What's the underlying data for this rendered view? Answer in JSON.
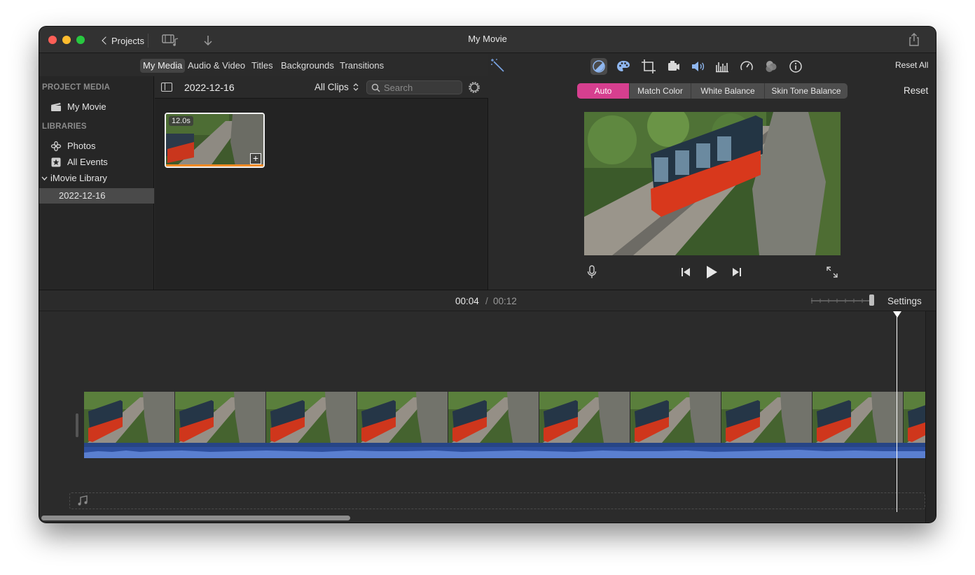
{
  "window": {
    "title": "My Movie"
  },
  "toolbar": {
    "projects_label": "Projects"
  },
  "browser_tabs": [
    "My Media",
    "Audio & Video",
    "Titles",
    "Backgrounds",
    "Transitions"
  ],
  "sidebar": {
    "project_media_header": "PROJECT MEDIA",
    "project_item": "My Movie",
    "libraries_header": "LIBRARIES",
    "photos": "Photos",
    "all_events": "All Events",
    "library": "iMovie Library",
    "event": "2022-12-16"
  },
  "browser": {
    "event_title": "2022-12-16",
    "filter": "All Clips",
    "search_placeholder": "Search",
    "clip_duration": "12.0s"
  },
  "viewer": {
    "reset_all": "Reset All",
    "reset": "Reset",
    "color_tabs": [
      "Auto",
      "Match Color",
      "White Balance",
      "Skin Tone Balance"
    ],
    "active_color_tab": "Auto",
    "accent_color": "#d63f8f"
  },
  "timeline": {
    "current_time": "00:04",
    "separator": "/",
    "total_time": "00:12",
    "settings_label": "Settings"
  }
}
